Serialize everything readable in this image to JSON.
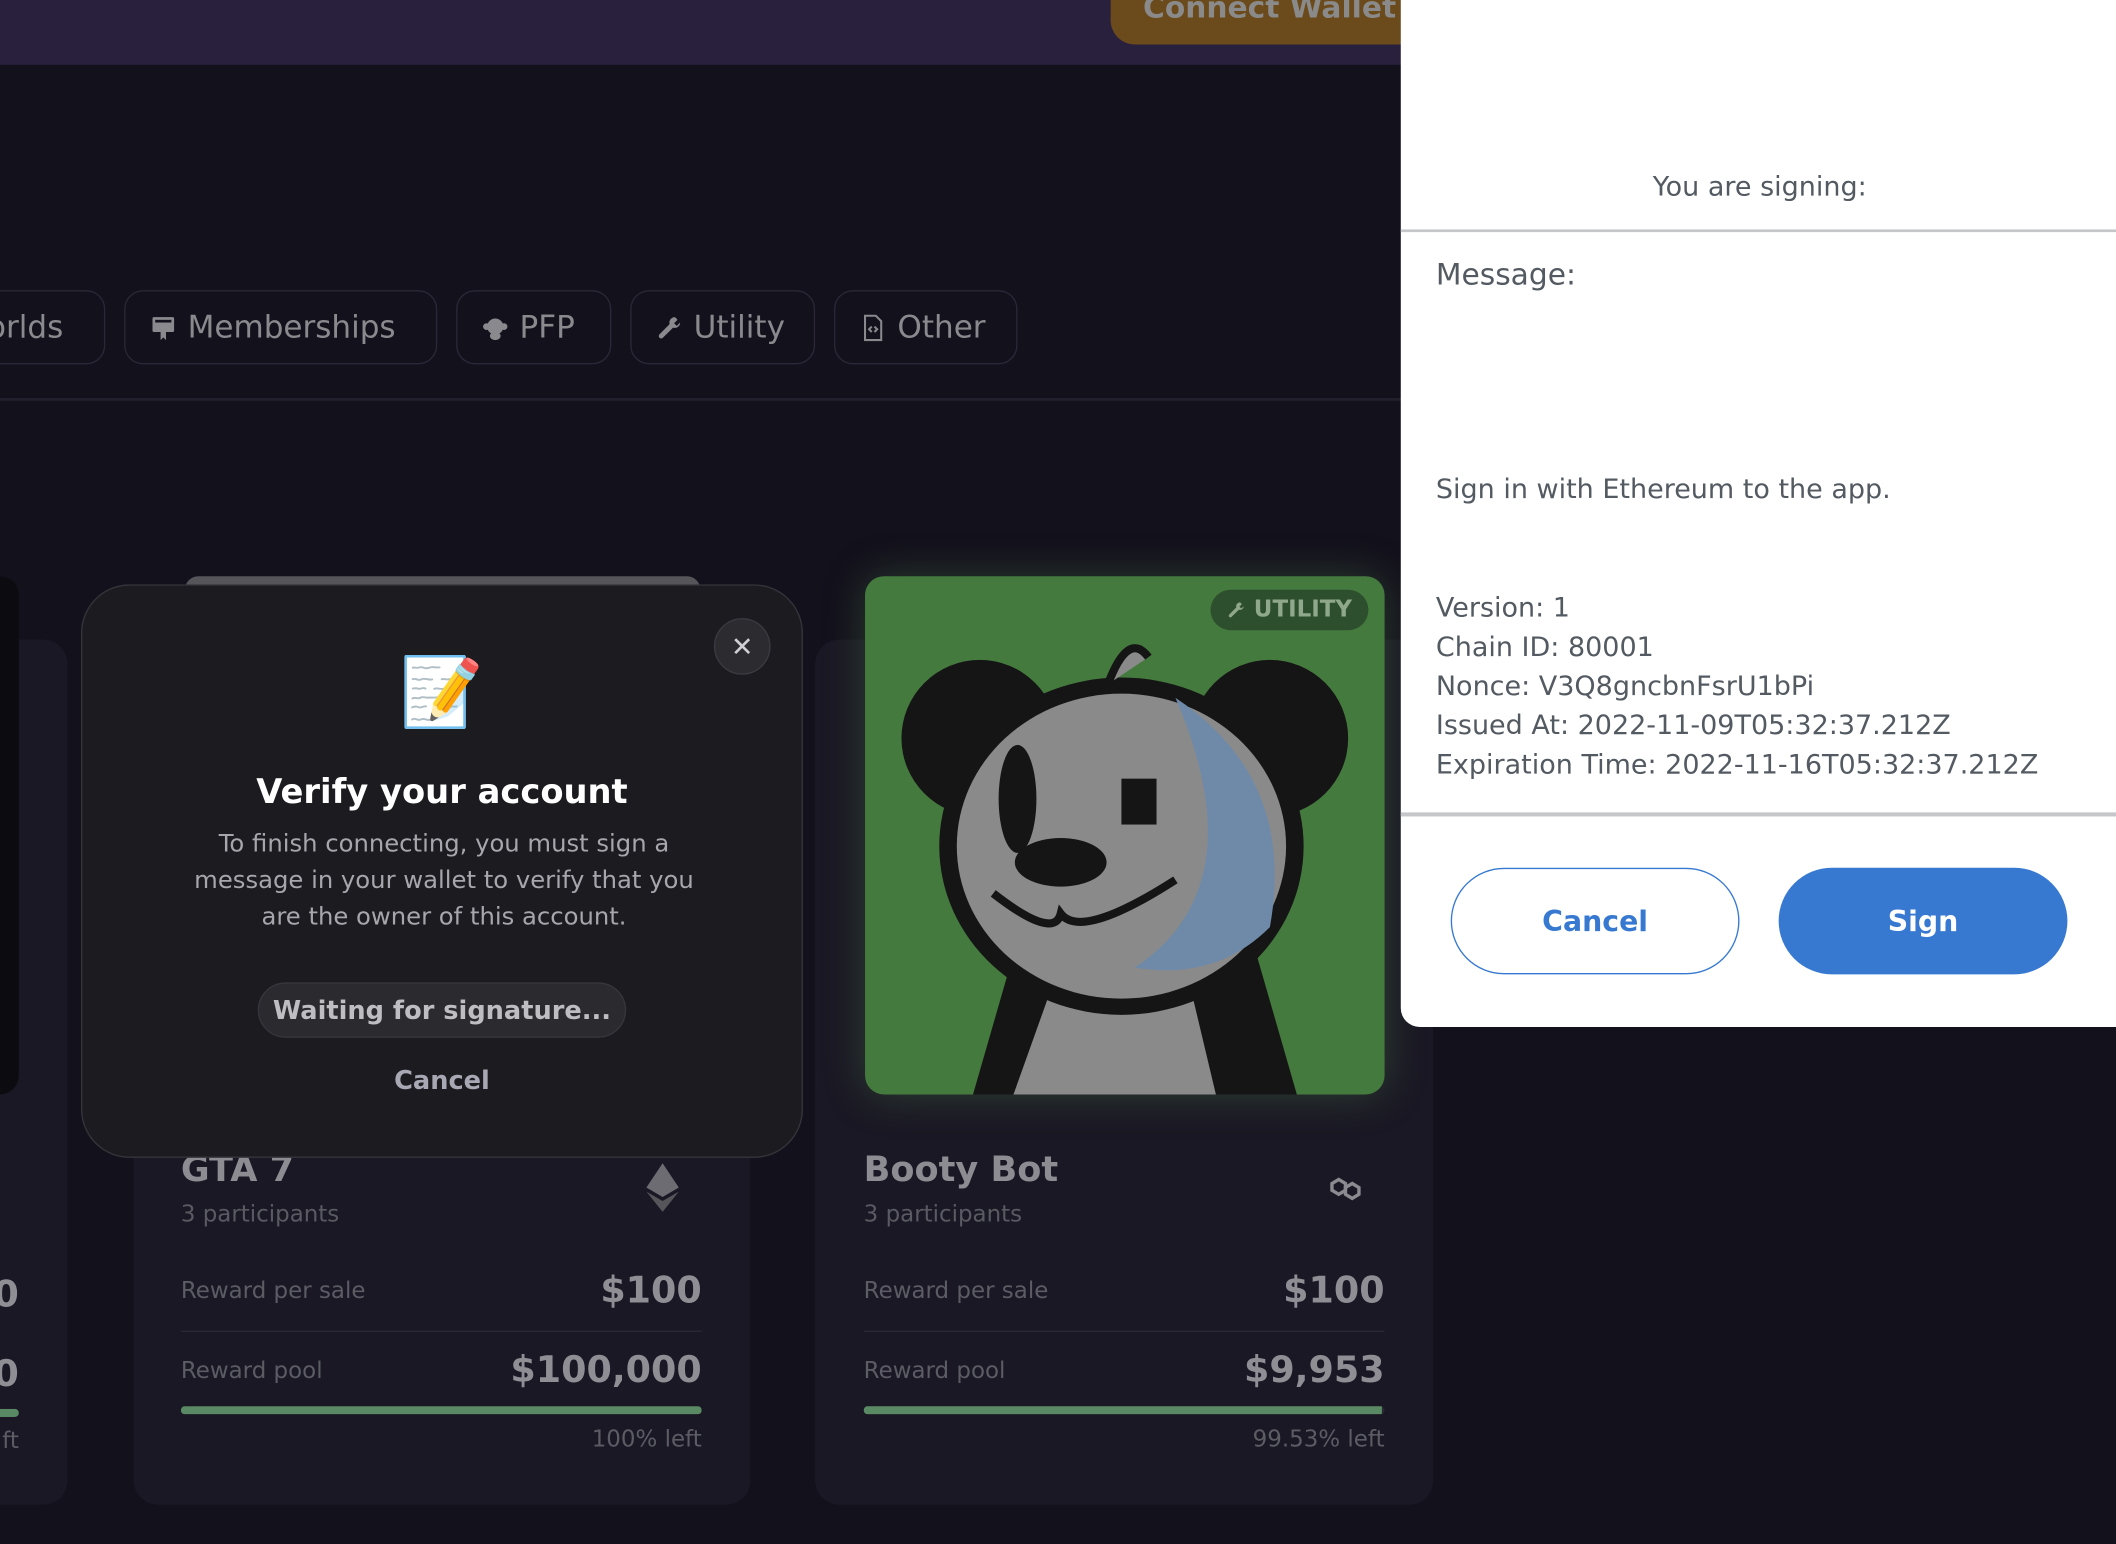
{
  "header": {
    "connect_wallet_label": "Connect Wallet"
  },
  "filters": [
    {
      "label": "Worlds",
      "icon": "globe-icon"
    },
    {
      "label": "Memberships",
      "icon": "membership-card-icon"
    },
    {
      "label": "PFP",
      "icon": "monkey-icon"
    },
    {
      "label": "Utility",
      "icon": "wrench-icon"
    },
    {
      "label": "Other",
      "icon": "file-code-icon"
    }
  ],
  "cards": [
    {
      "title": "GTA 7",
      "participants": "3 participants",
      "chain_icon": "ethereum-icon",
      "reward_per_sale_label": "Reward per sale",
      "reward_per_sale": "$100",
      "reward_pool_label": "Reward pool",
      "reward_pool": "$100,000",
      "percent_left": 100,
      "left_text": "100% left"
    },
    {
      "title": "Booty Bot",
      "participants": "3 participants",
      "chain_icon": "polygon-icon",
      "badge": "UTILITY",
      "reward_per_sale_label": "Reward per sale",
      "reward_per_sale": "$100",
      "reward_pool_label": "Reward pool",
      "reward_pool": "$9,953",
      "percent_left": 99.53,
      "left_text": "99.53% left"
    }
  ],
  "partial_card": {
    "value1": "0",
    "value2": "0",
    "left_text": "ft"
  },
  "verify_modal": {
    "emoji": "📝",
    "title": "Verify your account",
    "body": "To finish connecting, you must sign a message in your wallet to verify that you are the owner of this account.",
    "status": "Waiting for signature...",
    "cancel_label": "Cancel",
    "close_label": "✕"
  },
  "sign_panel": {
    "heading": "You are signing:",
    "message_label": "Message:",
    "statement": "Sign in with Ethereum to the app.",
    "details": [
      "Version: 1",
      "Chain ID: 80001",
      "Nonce: V3Q8gncbnFsrU1bPi",
      "Issued At: 2022-11-09T05:32:37.212Z",
      "Expiration Time: 2022-11-16T05:32:37.212Z"
    ],
    "cancel_label": "Cancel",
    "sign_label": "Sign"
  },
  "colors": {
    "accent": "#3779d1",
    "progress": "#5a8a63",
    "nft_bg": "#447a3e"
  }
}
